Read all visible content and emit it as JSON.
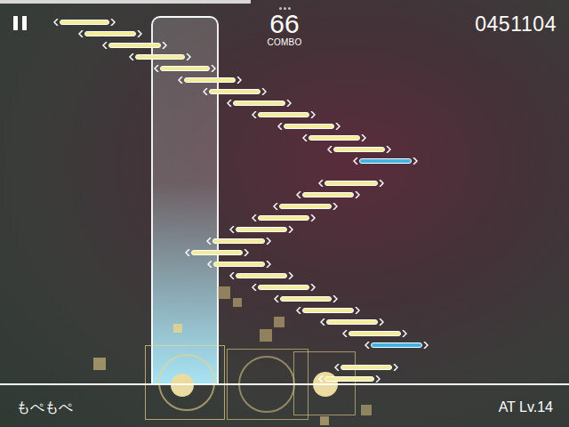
{
  "hud": {
    "combo": "66",
    "combo_label": "COMBO",
    "score": "0451104",
    "song": "もぺもぺ",
    "difficulty": "AT Lv.14"
  },
  "progress": {
    "level": 0.44
  },
  "hold_note": {
    "color": "#a8e4f5"
  },
  "notes": [
    {
      "color": "#f3ec9a"
    },
    {
      "color": "#f3ec9a"
    },
    {
      "color": "#f3ec9a"
    },
    {
      "color": "#f3ec9a"
    },
    {
      "color": "#f3ec9a"
    },
    {
      "color": "#f3ec9a"
    },
    {
      "color": "#f3ec9a"
    },
    {
      "color": "#f3ec9a"
    },
    {
      "color": "#f3ec9a"
    },
    {
      "color": "#f3ec9a"
    },
    {
      "color": "#f3ec9a"
    },
    {
      "color": "#f3ec9a"
    },
    {
      "color": "#3cb4e6"
    },
    {
      "color": "#f3ec9a"
    },
    {
      "color": "#f3ec9a"
    },
    {
      "color": "#f3ec9a"
    },
    {
      "color": "#f3ec9a"
    },
    {
      "color": "#f3ec9a"
    },
    {
      "color": "#f3ec9a"
    },
    {
      "color": "#f3ec9a"
    },
    {
      "color": "#f3ec9a"
    },
    {
      "color": "#f3ec9a"
    },
    {
      "color": "#f3ec9a"
    },
    {
      "color": "#f3ec9a"
    },
    {
      "color": "#f3ec9a"
    },
    {
      "color": "#f3ec9a"
    },
    {
      "color": "#f3ec9a"
    },
    {
      "color": "#3cb4e6"
    },
    {
      "color": "#f3ec9a"
    },
    {
      "color": "#f3ec9a"
    }
  ]
}
